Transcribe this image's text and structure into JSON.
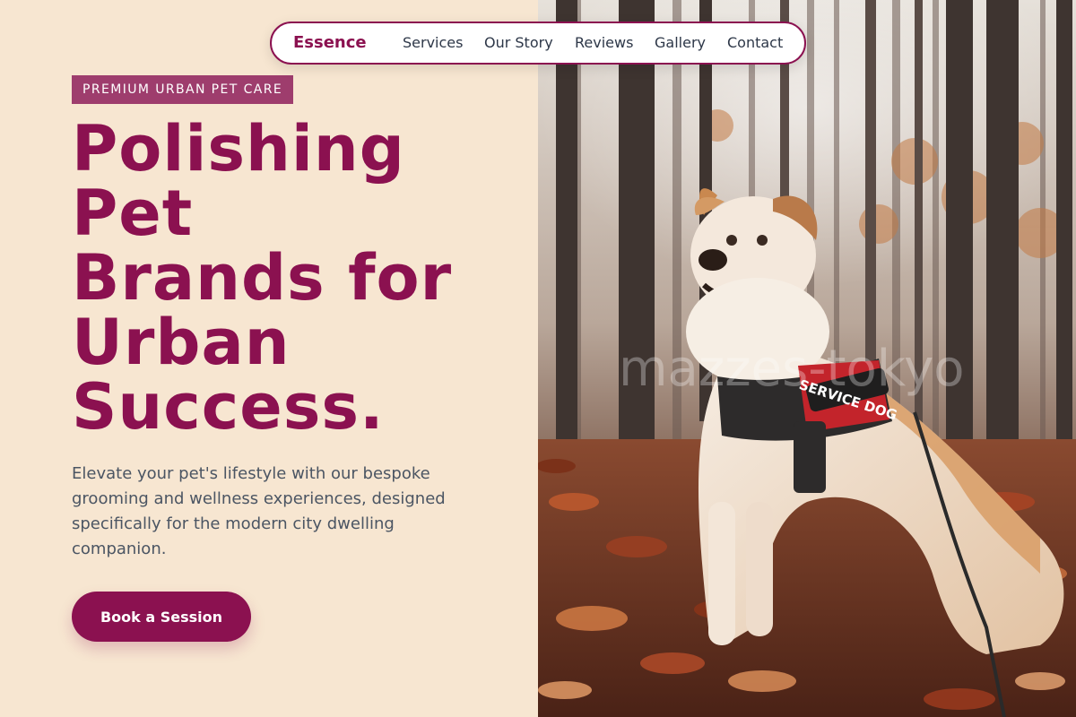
{
  "nav": {
    "brand": "Essence",
    "links": [
      "Services",
      "Our Story",
      "Reviews",
      "Gallery",
      "Contact"
    ]
  },
  "hero": {
    "eyebrow": "PREMIUM URBAN PET CARE",
    "headline": [
      "Polishing",
      "Pet",
      "Brands for",
      "Urban",
      "Success."
    ],
    "lede": "Elevate your pet's lifestyle with our bespoke grooming and wellness experiences, designed specifically for the modern city dwelling companion.",
    "cta": "Book a Session"
  },
  "photo": {
    "harness_text": "SERVICE DOG",
    "watermark": "mazzes-tokyo"
  },
  "colors": {
    "accent": "#8b1150",
    "eyebrow_bg": "#9e3d6d",
    "page_bg": "#f7e6d1",
    "body_text": "#4b5563"
  }
}
